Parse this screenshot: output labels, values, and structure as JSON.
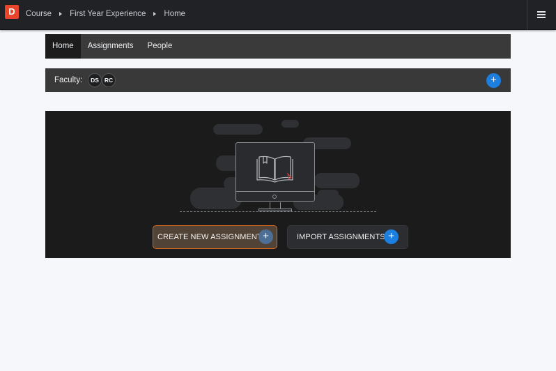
{
  "app": {
    "logo_letter": "D",
    "brand_color": "#e8452c",
    "menu_icon": "hamburger-icon"
  },
  "breadcrumb": [
    "Course",
    "First Year Experience",
    "Home"
  ],
  "tabs": [
    {
      "label": "Home",
      "active": true
    },
    {
      "label": "Assignments",
      "active": false
    },
    {
      "label": "People",
      "active": false
    }
  ],
  "faculty": {
    "label": "Faculty:",
    "members": [
      "DS",
      "RC"
    ],
    "add_icon": "plus-icon"
  },
  "hero": {
    "illustration": "monitor-with-book-icon",
    "create_label": "CREATE NEW ASSIGNMENT",
    "import_label": "IMPORT ASSIGNMENTS",
    "plus_symbol": "+",
    "accent_color": "#d86a22",
    "primary_blue": "#1c7fe0"
  }
}
